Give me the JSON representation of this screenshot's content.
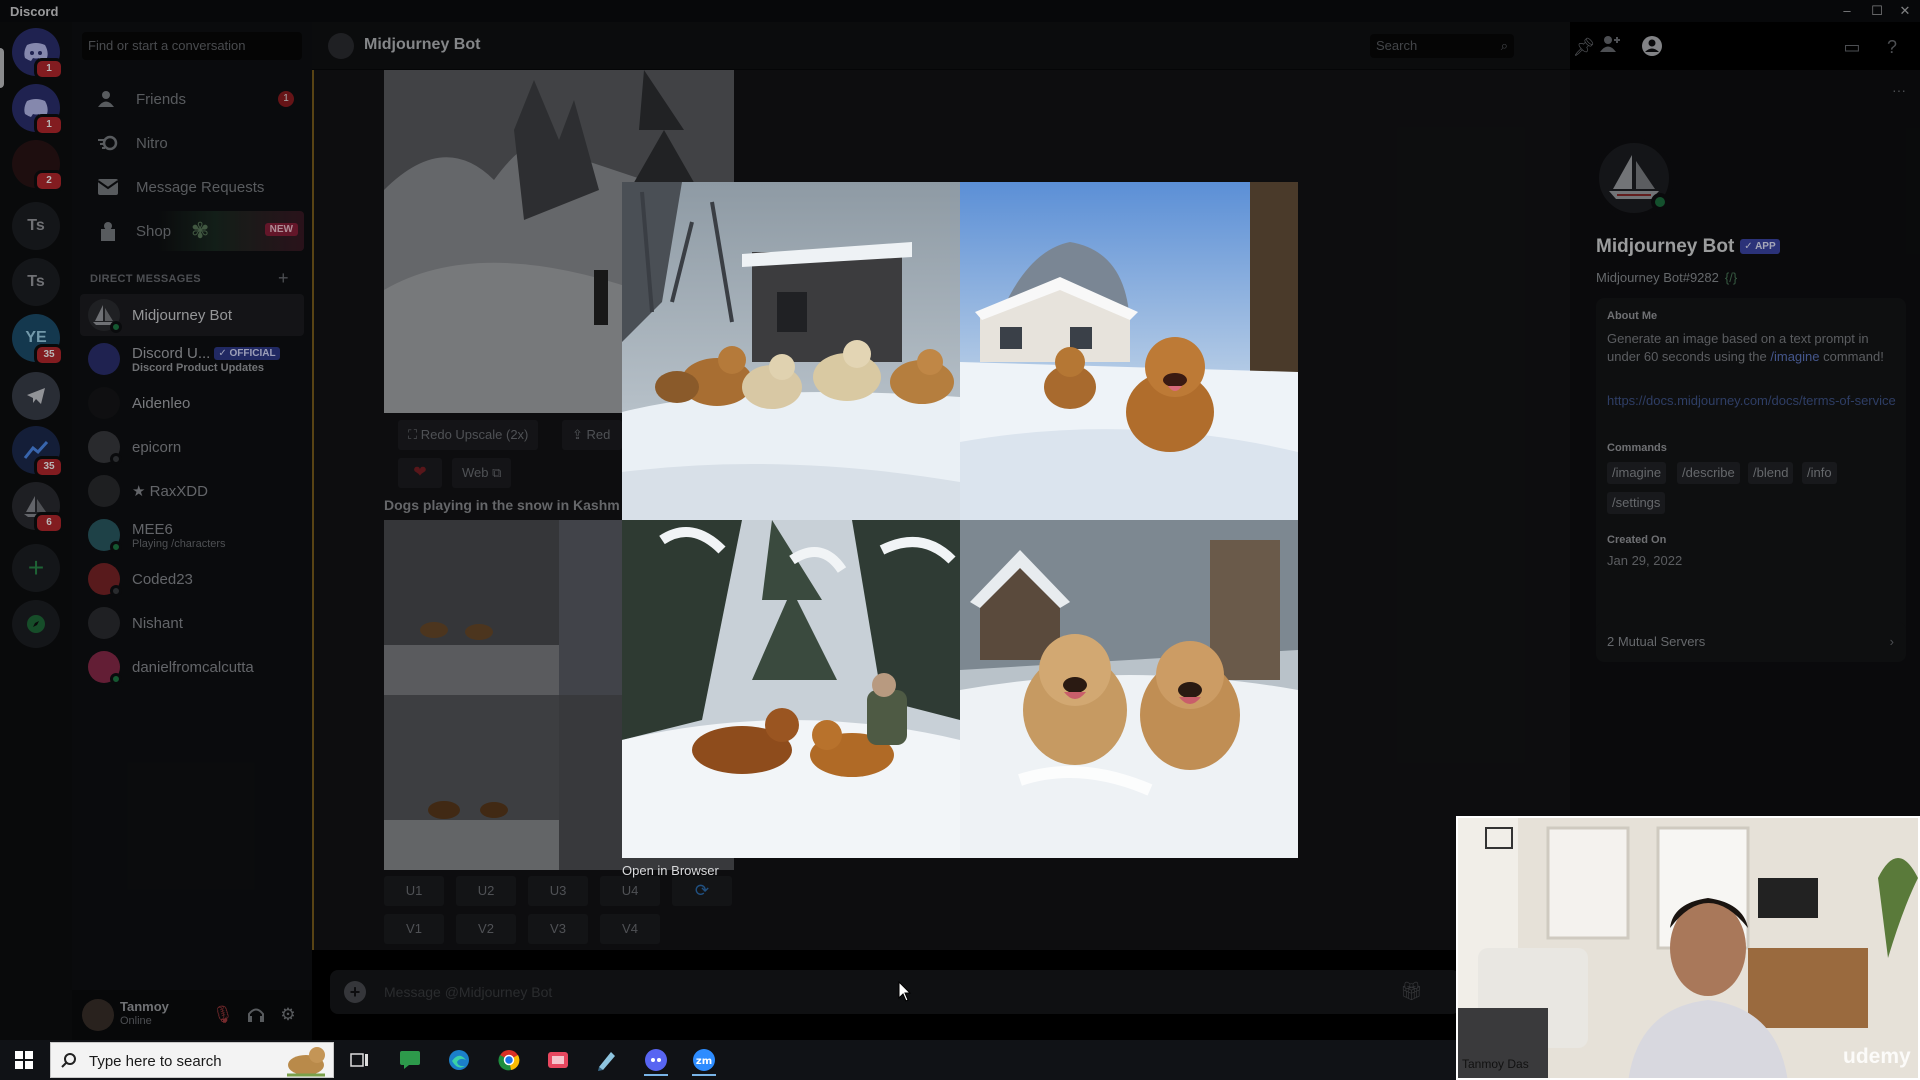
{
  "window": {
    "app_name": "Discord"
  },
  "rail": {
    "servers": [
      {
        "label": "",
        "badge": "1"
      },
      {
        "label": "",
        "badge": "1"
      },
      {
        "label": "",
        "badge": "2"
      },
      {
        "label": "Ts",
        "badge": ""
      },
      {
        "label": "Ts",
        "badge": ""
      },
      {
        "label": "YE",
        "badge": "35"
      },
      {
        "label": "",
        "badge": ""
      },
      {
        "label": "",
        "badge": "35"
      },
      {
        "label": "",
        "badge": "6"
      }
    ]
  },
  "sidebar": {
    "search_placeholder": "Find or start a conversation",
    "nav": [
      {
        "label": "Friends",
        "badge": "1"
      },
      {
        "label": "Nitro"
      },
      {
        "label": "Message Requests"
      },
      {
        "label": "Shop",
        "tag": "NEW"
      }
    ],
    "dm_header": "DIRECT MESSAGES",
    "dms": [
      {
        "name": "Midjourney Bot",
        "sub": ""
      },
      {
        "name": "Discord U...",
        "tag": "✓ OFFICIAL",
        "sub": "Discord Product Updates"
      },
      {
        "name": "Aidenleo",
        "sub": ""
      },
      {
        "name": "epicorn",
        "sub": ""
      },
      {
        "name": "★ RaxXDD",
        "sub": ""
      },
      {
        "name": "MEE6",
        "sub": "Playing /characters"
      },
      {
        "name": "Coded23",
        "sub": ""
      },
      {
        "name": "Nishant",
        "sub": ""
      },
      {
        "name": "danielfromcalcutta",
        "sub": ""
      }
    ],
    "user": {
      "name": "Tanmoy",
      "status": "Online"
    }
  },
  "chat": {
    "title": "Midjourney Bot",
    "header_search": "Search",
    "upscale_buttons": [
      "Redo Upscale (2x)",
      "Red"
    ],
    "web_button": "Web",
    "prompt_text": "Dogs playing in the snow in Kashm",
    "u_buttons": [
      "U1",
      "U2",
      "U3",
      "U4"
    ],
    "v_buttons": [
      "V1",
      "V2",
      "V3",
      "V4"
    ],
    "message_placeholder": "Message @Midjourney Bot"
  },
  "profile": {
    "name": "Midjourney Bot",
    "app_tag": "✓ APP",
    "tag": "Midjourney Bot#9282",
    "about_header": "About Me",
    "about_text_1": "Generate an image based on a text prompt in under 60 seconds using the",
    "about_link": "/imagine",
    "about_text_2": "command!",
    "url": "https://docs.midjourney.com/docs/terms-of-service",
    "commands_header": "Commands",
    "commands": [
      "/imagine",
      "/describe",
      "/blend",
      "/info",
      "/settings"
    ],
    "created_header": "Created On",
    "created_date": "Jan 29, 2022",
    "mutual": "2 Mutual Servers"
  },
  "lightbox": {
    "open_link": "Open in Browser"
  },
  "taskbar": {
    "search_placeholder": "Type here to search"
  },
  "webcam": {
    "name": "Tanmoy Das",
    "watermark": "udemy"
  },
  "colors": {
    "accent": "#5865f2",
    "online": "#23a55a",
    "notification": "#ed4245"
  }
}
